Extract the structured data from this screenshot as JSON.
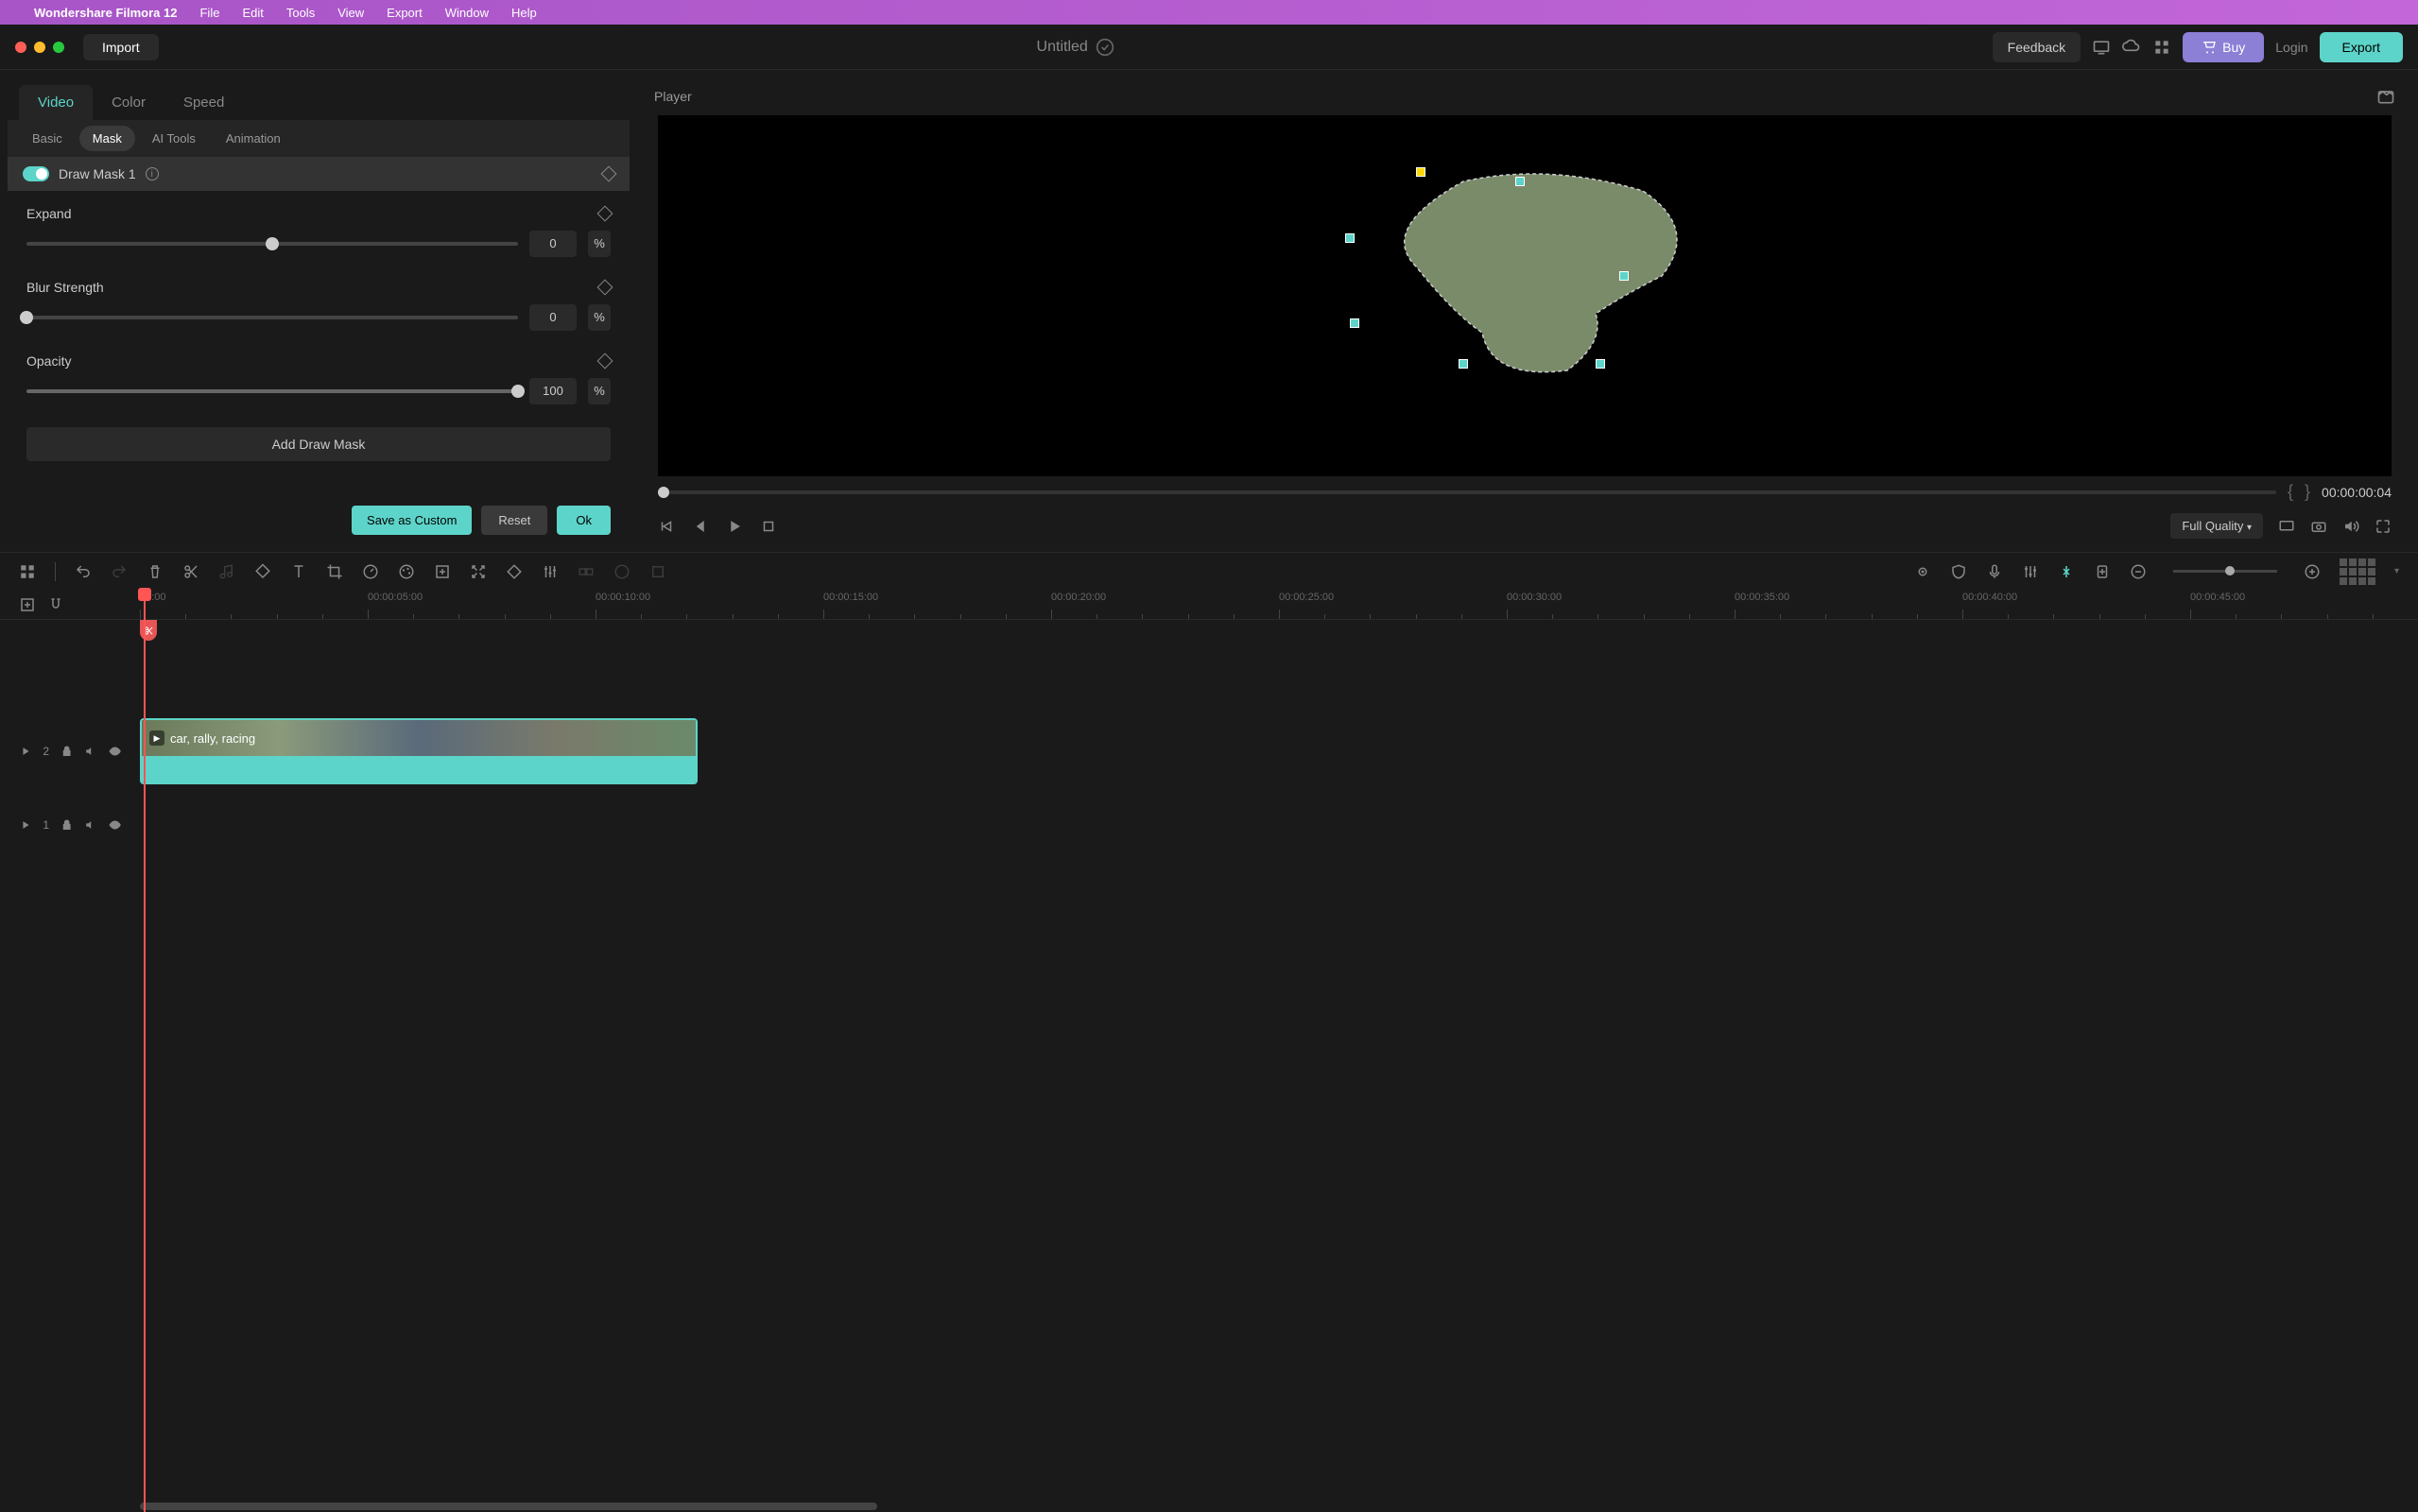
{
  "menubar": {
    "app": "Wondershare Filmora 12",
    "items": [
      "File",
      "Edit",
      "Tools",
      "View",
      "Export",
      "Window",
      "Help"
    ]
  },
  "toolbar": {
    "import": "Import",
    "project_title": "Untitled",
    "feedback": "Feedback",
    "buy": "Buy",
    "login": "Login",
    "export": "Export"
  },
  "panel": {
    "tabs_primary": [
      "Video",
      "Color",
      "Speed"
    ],
    "tabs_primary_active": 0,
    "tabs_secondary": [
      "Basic",
      "Mask",
      "AI Tools",
      "Animation"
    ],
    "tabs_secondary_active": 1,
    "mask_title": "Draw Mask 1",
    "expand": {
      "label": "Expand",
      "value": "0",
      "unit": "%",
      "pos": 50
    },
    "blur": {
      "label": "Blur Strength",
      "value": "0",
      "unit": "%",
      "pos": 0
    },
    "opacity": {
      "label": "Opacity",
      "value": "100",
      "unit": "%",
      "pos": 100
    },
    "add_mask": "Add Draw Mask",
    "save_custom": "Save as Custom",
    "reset": "Reset",
    "ok": "Ok"
  },
  "player": {
    "title": "Player",
    "timecode": "00:00:00:04",
    "quality": "Full Quality"
  },
  "timeline": {
    "ticks": [
      "00:00",
      "00:00:05:00",
      "00:00:10:00",
      "00:00:15:00",
      "00:00:20:00",
      "00:00:25:00",
      "00:00:30:00",
      "00:00:35:00",
      "00:00:40:00",
      "00:00:45:00"
    ],
    "track2": "2",
    "track1": "1",
    "clip_label": "car, rally, racing"
  }
}
